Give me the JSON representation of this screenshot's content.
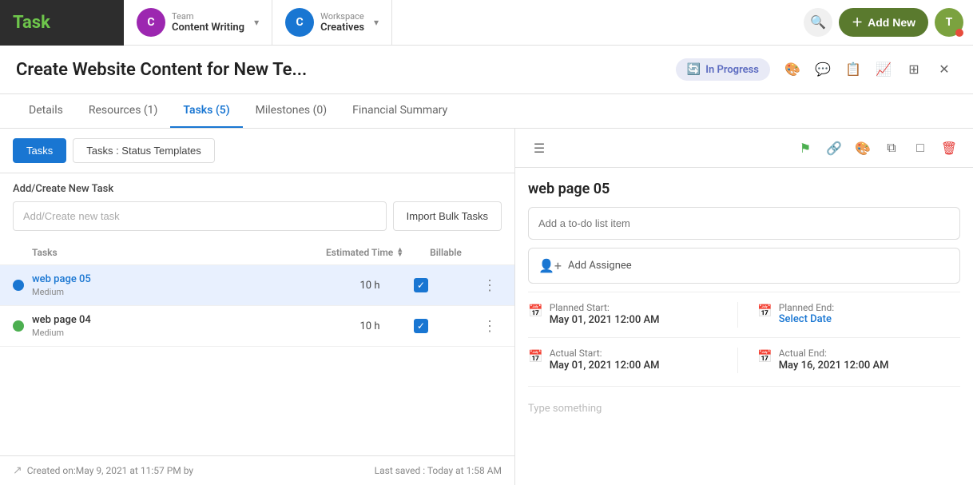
{
  "app": {
    "logo": "Task"
  },
  "nav": {
    "team_workspace": {
      "sub": "Team",
      "main": "Content Writing",
      "avatar_letter": "C",
      "avatar_color": "#9c27b0"
    },
    "workspace": {
      "sub": "Workspace",
      "main": "Creatives",
      "avatar_letter": "C",
      "avatar_color": "#1976d2"
    },
    "add_new_label": "Add New",
    "user_letter": "T"
  },
  "page": {
    "title": "Create Website Content for New Te...",
    "status": "In Progress",
    "close_label": "×"
  },
  "tabs": [
    {
      "id": "details",
      "label": "Details",
      "active": false
    },
    {
      "id": "resources",
      "label": "Resources (1)",
      "active": false
    },
    {
      "id": "tasks",
      "label": "Tasks (5)",
      "active": true
    },
    {
      "id": "milestones",
      "label": "Milestones (0)",
      "active": false
    },
    {
      "id": "financial",
      "label": "Financial Summary",
      "active": false
    }
  ],
  "sub_tabs": [
    {
      "id": "tasks",
      "label": "Tasks",
      "active": true
    },
    {
      "id": "status_templates",
      "label": "Tasks : Status Templates",
      "active": false
    }
  ],
  "task_create": {
    "label": "Add/Create New Task",
    "placeholder": "Add/Create new task",
    "import_button": "Import Bulk Tasks"
  },
  "task_table": {
    "headers": {
      "tasks": "Tasks",
      "estimated_time": "Estimated Time",
      "billable": "Billable"
    },
    "rows": [
      {
        "id": "wp05",
        "name": "web page 05",
        "priority": "Medium",
        "estimated_time": "10 h",
        "billable": true,
        "selected": true,
        "dot_color": "#1976d2"
      },
      {
        "id": "wp04",
        "name": "web page 04",
        "priority": "Medium",
        "estimated_time": "10 h",
        "billable": true,
        "selected": false,
        "dot_color": "#4caf50"
      }
    ]
  },
  "footer": {
    "created": "Created on:May 9, 2021 at 11:57 PM by",
    "last_saved": "Last saved : Today at 1:58 AM"
  },
  "task_detail": {
    "title": "web page 05",
    "todo_placeholder": "Add a to-do list item",
    "assignee_label": "Add Assignee",
    "planned_start_label": "Planned Start:",
    "planned_start_value": "May 01, 2021 12:00 AM",
    "planned_end_label": "Planned End:",
    "planned_end_value": "Select Date",
    "actual_start_label": "Actual Start:",
    "actual_start_value": "May 01, 2021 12:00 AM",
    "actual_end_label": "Actual End:",
    "actual_end_value": "May 16, 2021 12:00 AM",
    "comment_placeholder": "Type something"
  }
}
